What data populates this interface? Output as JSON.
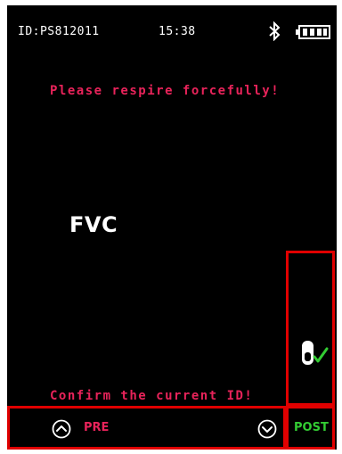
{
  "status_bar": {
    "id_text": "ID:PS812011",
    "time": "15:38",
    "bluetooth_icon": "bluetooth-icon",
    "battery_icon": "battery-full-icon"
  },
  "main": {
    "prompt": "Please respire forcefully!",
    "mode": "FVC",
    "confirm_text": "Confirm the current ID!",
    "device_icon": "mouthpiece-check-icon"
  },
  "bottom_bar": {
    "up_icon": "chevron-up-circle-icon",
    "pre_label": "PRE",
    "down_icon": "chevron-down-circle-icon",
    "post_label": "POST"
  },
  "colors": {
    "background": "#000000",
    "prompt_text": "#e8235a",
    "highlight_border": "#e00000",
    "post_text": "#33cc33",
    "check_mark": "#33cc33"
  }
}
